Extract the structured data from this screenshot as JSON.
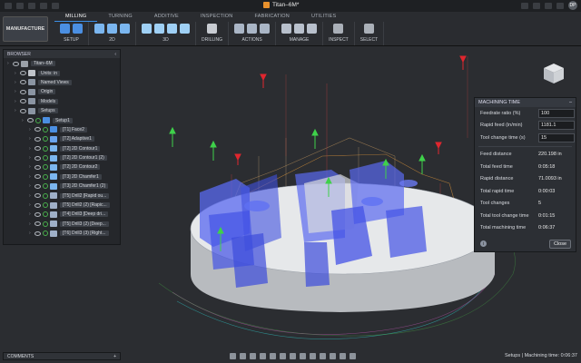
{
  "window": {
    "title": "Titan–6M*"
  },
  "account": {
    "initials": "DP"
  },
  "workspace": {
    "label": "MANUFACTURE"
  },
  "tabs": [
    {
      "label": "MILLING",
      "active": true
    },
    {
      "label": "TURNING"
    },
    {
      "label": "ADDITIVE"
    },
    {
      "label": "INSPECTION"
    },
    {
      "label": "FABRICATION"
    },
    {
      "label": "UTILITIES"
    }
  ],
  "groups": [
    {
      "label": "SETUP",
      "icons": [
        "setup-icon",
        "setup-sheet-icon"
      ],
      "color": "#4b8fe2"
    },
    {
      "label": "2D",
      "icons": [
        "2d-adaptive-icon",
        "2d-pocket-icon",
        "2d-contour-icon"
      ],
      "color": "#7bb6ef"
    },
    {
      "label": "3D",
      "icons": [
        "3d-adaptive-icon",
        "3d-pocket-icon",
        "3d-parallel-icon",
        "3d-scallop-icon"
      ],
      "color": "#9fd0f5"
    },
    {
      "label": "DRILLING",
      "icons": [
        "drill-icon"
      ],
      "color": "#c8ccd2"
    },
    {
      "label": "ACTIONS",
      "icons": [
        "simulate-icon",
        "post-process-icon",
        "setup-sheet-icon"
      ],
      "color": "#aab6c6"
    },
    {
      "label": "MANAGE",
      "icons": [
        "tool-library-icon",
        "template-library-icon",
        "post-library-icon"
      ],
      "color": "#b8c0cc"
    },
    {
      "label": "INSPECT",
      "icons": [
        "measure-icon"
      ],
      "color": "#aab0b8"
    },
    {
      "label": "SELECT",
      "icons": [
        "select-arrow-icon"
      ],
      "color": "#aab0b8"
    }
  ],
  "browser": {
    "title": "BROWSER",
    "items": [
      {
        "label": "Titan–6M",
        "depth": 0,
        "icon": "document-icon"
      },
      {
        "label": "Units: in",
        "depth": 1,
        "icon": "units-icon"
      },
      {
        "label": "Named Views",
        "depth": 1,
        "icon": "folder-icon"
      },
      {
        "label": "Origin",
        "depth": 1,
        "icon": "folder-icon"
      },
      {
        "label": "Models",
        "depth": 1,
        "icon": "folder-icon"
      },
      {
        "label": "Setups",
        "depth": 1,
        "icon": "folder-icon"
      },
      {
        "label": "Setup1",
        "depth": 2,
        "icon": "setup-icon"
      },
      {
        "label": "[T1] Face2",
        "depth": 3,
        "icon": "face-op-icon"
      },
      {
        "label": "[T2] Adaptive1",
        "depth": 3,
        "icon": "adaptive-op-icon"
      },
      {
        "label": "[T2] 2D Contour1",
        "depth": 3,
        "icon": "contour-op-icon"
      },
      {
        "label": "[T2] 2D Contour1 (2)",
        "depth": 3,
        "icon": "contour-op-icon"
      },
      {
        "label": "[T2] 2D Contour2",
        "depth": 3,
        "icon": "contour-op-icon"
      },
      {
        "label": "[T3] 2D Chamfer1",
        "depth": 3,
        "icon": "chamfer-op-icon"
      },
      {
        "label": "[T3] 2D Chamfer1 (2)",
        "depth": 3,
        "icon": "chamfer-op-icon"
      },
      {
        "label": "[T5] Drill2 [Rapid ou...",
        "depth": 3,
        "icon": "drill-op-icon"
      },
      {
        "label": "[T5] Drill2 (2) [Rapic...",
        "depth": 3,
        "icon": "drill-op-icon"
      },
      {
        "label": "[T4] Drill3 [Deep dri...",
        "depth": 3,
        "icon": "drill-op-icon"
      },
      {
        "label": "[T5] Drill3 (2) [Deep...",
        "depth": 3,
        "icon": "drill-op-icon"
      },
      {
        "label": "[T6] Drill3 (3) [Right...",
        "depth": 3,
        "icon": "drill-op-icon"
      }
    ]
  },
  "comments": {
    "title": "COMMENTS"
  },
  "machining_time": {
    "title": "MACHINING TIME",
    "inputs": [
      {
        "label": "Feedrate ratio (%)",
        "value": "100"
      },
      {
        "label": "Rapid feed (in/min)",
        "value": "1181.1"
      },
      {
        "label": "Tool change time (s)",
        "value": "15"
      }
    ],
    "results": [
      {
        "label": "Feed distance",
        "value": "220.198 in"
      },
      {
        "label": "Total feed time",
        "value": "0:05:18"
      },
      {
        "label": "Rapid distance",
        "value": "71.0093 in"
      },
      {
        "label": "Total rapid time",
        "value": "0:00:03"
      },
      {
        "label": "Tool changes",
        "value": "5"
      },
      {
        "label": "Total tool change time",
        "value": "0:01:15"
      },
      {
        "label": "Total machining time",
        "value": "0:06:37"
      }
    ],
    "close_label": "Close"
  },
  "status": {
    "text": "Setups | Machining time: 0:06:37"
  },
  "colors": {
    "accent": "#3a8ee6",
    "tool_green": "#3fd14a",
    "tool_red": "#e0262e",
    "part_blue": "#4a5ee8"
  }
}
